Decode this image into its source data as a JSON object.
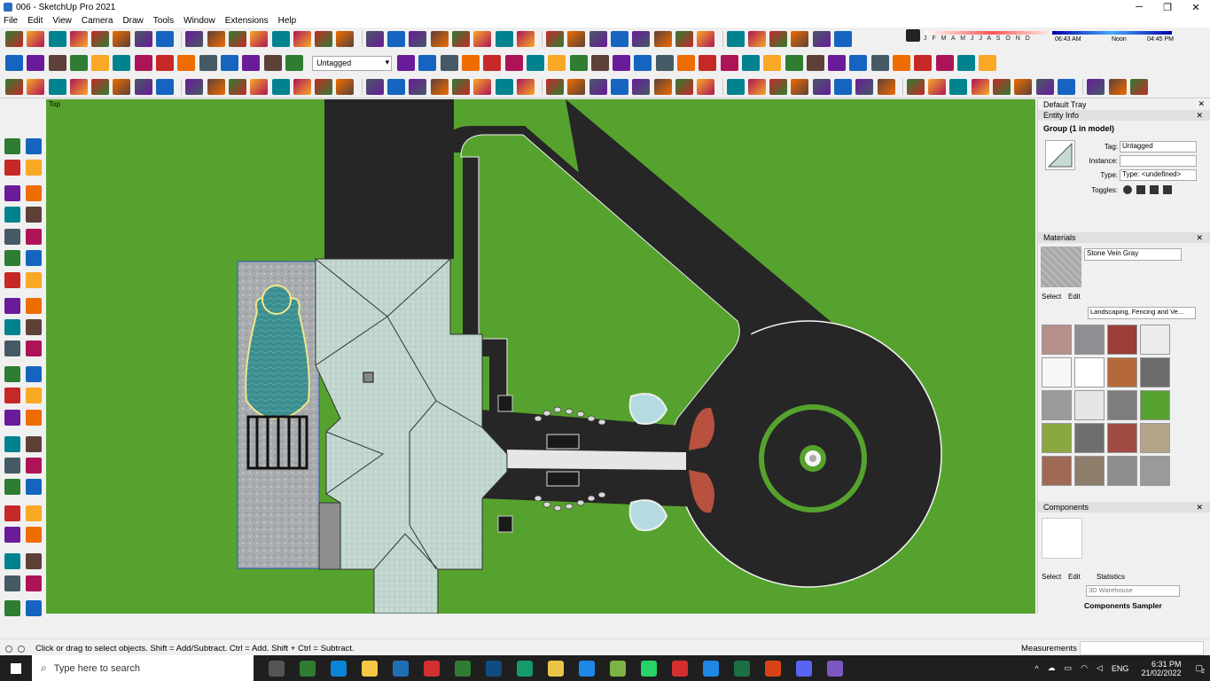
{
  "window": {
    "title": "006 - SketchUp Pro 2021",
    "minimize": "─",
    "restore": "❐",
    "close": "✕"
  },
  "menu": [
    "File",
    "Edit",
    "View",
    "Camera",
    "Draw",
    "Tools",
    "Window",
    "Extensions",
    "Help"
  ],
  "toolbar": {
    "tag_selector": "Untagged"
  },
  "shadow": {
    "months": "J F M A M J J A S O N D",
    "time_start": "06:43 AM",
    "time_noon": "Noon",
    "time_end": "04:45 PM"
  },
  "viewport": {
    "view_label": "Top",
    "colors": {
      "grass": "#56a22e",
      "asphalt": "#262626",
      "roof": "#c3d8d0",
      "deck": "#aeb1b3",
      "pool": "#3a8b8d",
      "clay": "#b8513f"
    }
  },
  "tray": {
    "title": "Default Tray",
    "entity_info": {
      "header": "Entity Info",
      "selection": "Group (1 in model)",
      "tag_label": "Tag:",
      "tag_value": "Untagged",
      "instance_label": "Instance:",
      "instance_value": "",
      "type_label": "Type:",
      "type_value": "Type: <undefined>",
      "toggles_label": "Toggles:"
    },
    "materials": {
      "header": "Materials",
      "name": "Stone Vein Gray",
      "tab_select": "Select",
      "tab_edit": "Edit",
      "library": "Landscaping, Fencing and Ve...",
      "swatches": [
        "#b58f88",
        "#8d8f92",
        "#9b3d38",
        "#ececec",
        "#f8f8f8",
        "#ffffff",
        "#b5693a",
        "#6b6b6b",
        "#9a9a9a",
        "#e6e6e6",
        "#7d7d7d",
        "#56a22e",
        "#8aa83f",
        "#6e6e6e",
        "#9f4b43",
        "#b4a48a",
        "#9e6a55",
        "#8d7d6b",
        "#8d8d8d",
        "#9a9a9a"
      ]
    },
    "components": {
      "header": "Components",
      "tab_select": "Select",
      "tab_edit": "Edit",
      "tab_statistics": "Statistics",
      "search_placeholder": "3D Warehouse",
      "collection": "Components Sampler"
    }
  },
  "status": {
    "hint": "Click or drag to select objects. Shift = Add/Subtract. Ctrl = Add. Shift + Ctrl = Subtract.",
    "measurements_label": "Measurements"
  },
  "taskbar": {
    "search_placeholder": "Type here to search",
    "language": "ENG",
    "time": "6:31 PM",
    "date": "21/02/2022",
    "notification_count": "2"
  }
}
